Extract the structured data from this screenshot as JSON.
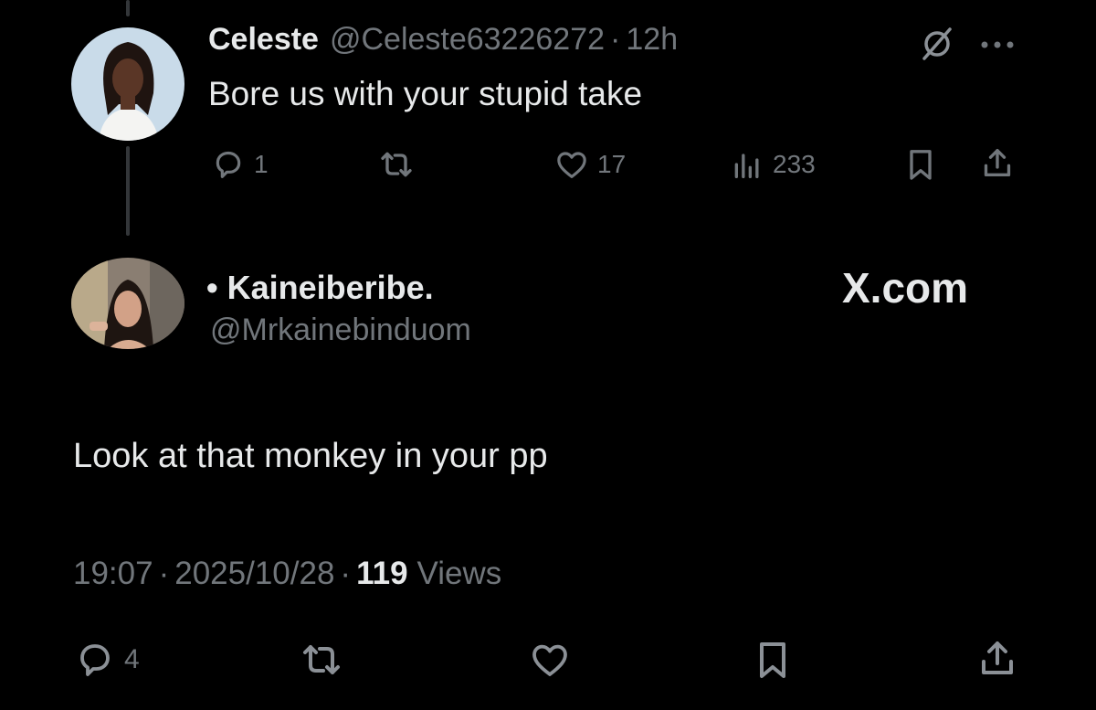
{
  "reply_tweet": {
    "display_name": "Celeste",
    "handle": "@Celeste63226272",
    "separator": "·",
    "time_ago": "12h",
    "text": "Bore us with your stupid take",
    "actions": {
      "replies": "1",
      "likes": "17",
      "views": "233"
    },
    "icons": [
      "grok-icon",
      "more-icon",
      "reply-icon",
      "retweet-icon",
      "like-icon",
      "views-icon",
      "bookmark-icon",
      "share-icon"
    ]
  },
  "main_tweet": {
    "display_name": "• Kaineiberibe.",
    "handle": "@Mrkainebinduom",
    "text": "Look at that monkey in your pp",
    "timestamp_time": "19:07",
    "timestamp_date": "2025/10/28",
    "separator": "·",
    "views_count": "119",
    "views_label": "Views",
    "actions": {
      "replies": "4"
    },
    "icons": [
      "reply-icon",
      "retweet-icon",
      "like-icon",
      "bookmark-icon",
      "share-icon"
    ]
  },
  "watermark": {
    "text": "X.com"
  },
  "colors": {
    "background": "#000000",
    "text_primary": "#e7e9ea",
    "text_muted": "#71767b",
    "thread_line": "#333639"
  }
}
